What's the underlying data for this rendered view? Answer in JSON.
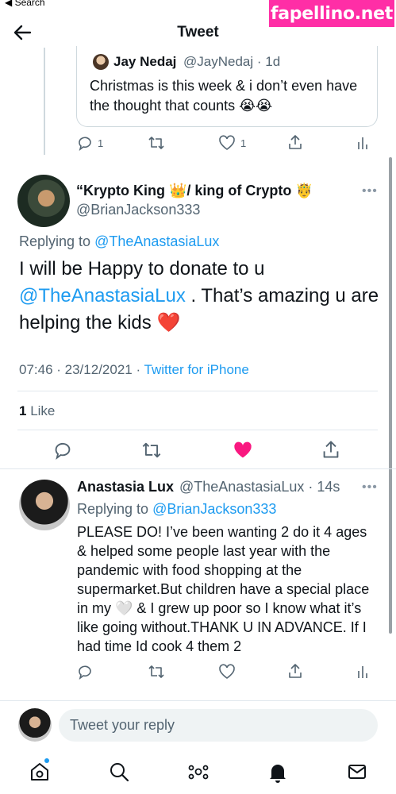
{
  "status_bar": {
    "back_label": "◀ Search"
  },
  "watermark": "fapellino.net",
  "header": {
    "title": "Tweet"
  },
  "quoted_tweet": {
    "author_name": "Jay Nedaj",
    "author_handle": "@JayNedaj · 1d",
    "text": "Christmas is this week & i don’t even have the thought that counts 😭😭",
    "reply_count": "1",
    "like_count": "1"
  },
  "main_tweet": {
    "author_name": "“Krypto King 👑/ king of Crypto 🤴",
    "author_handle": "@BrianJackson333",
    "replying_prefix": "Replying to ",
    "replying_to": "@TheAnastasiaLux",
    "text_part1": "I will be Happy to donate to u ",
    "text_mention": "@TheAnastasiaLux",
    "text_part2": " .  That’s amazing u are helping the kids ❤️",
    "timestamp": "07:46 · 23/12/2021 · ",
    "source": "Twitter for iPhone",
    "likes_count": "1",
    "likes_label": " Like"
  },
  "reply_tweet": {
    "author_name": "Anastasia Lux",
    "author_handle": "@TheAnastasiaLux · 14s",
    "replying_prefix": "Replying to ",
    "replying_to": "@BrianJackson333",
    "text": "PLEASE DO! I’ve been wanting 2 do it 4 ages & helped some people last year with the pandemic with food shopping at the supermarket.But children have a special place in my 🤍 & I grew up poor so I know what it’s like going without.THANK U IN ADVANCE. If I had time Id cook 4 them 2"
  },
  "compose": {
    "placeholder": "Tweet your reply"
  },
  "bottom_nav": [
    "home-icon",
    "search-icon",
    "spaces-icon",
    "notifications-icon",
    "messages-icon"
  ],
  "colors": {
    "accent": "#1d9bf0",
    "like": "#f91880",
    "watermark": "#ff2ea6"
  }
}
